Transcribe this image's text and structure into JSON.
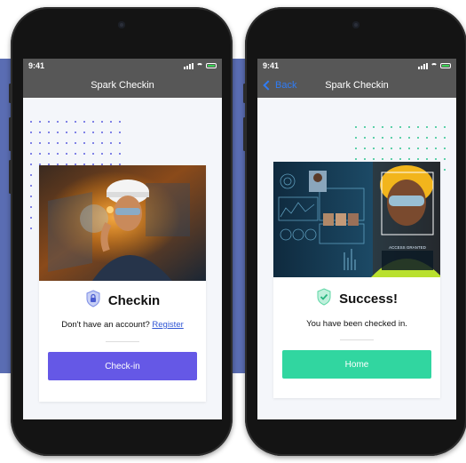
{
  "left_phone": {
    "status_time": "9:41",
    "nav_title": "Spark Checkin",
    "card_title": "Checkin",
    "prompt_text": "Don't have an account?",
    "register_link": "Register",
    "button_label": "Check-in",
    "photo_icon": "worker-hardhat-photo",
    "title_icon": "shield-lock-icon"
  },
  "right_phone": {
    "status_time": "9:41",
    "back_label": "Back",
    "nav_title": "Spark Checkin",
    "card_title": "Success!",
    "message_text": "You have been checked in.",
    "button_label": "Home",
    "photo_icon": "face-scan-photo",
    "photo_caption": "ACCESS GRANTED",
    "title_icon": "shield-check-icon"
  },
  "colors": {
    "background_band": "#5a6db3",
    "primary_button": "#6558e6",
    "success_button": "#31d6a0",
    "nav_bar": "#575757",
    "link": "#2f55d4",
    "left_dots": "#5a5ee0",
    "right_dots": "#2dc58f"
  }
}
